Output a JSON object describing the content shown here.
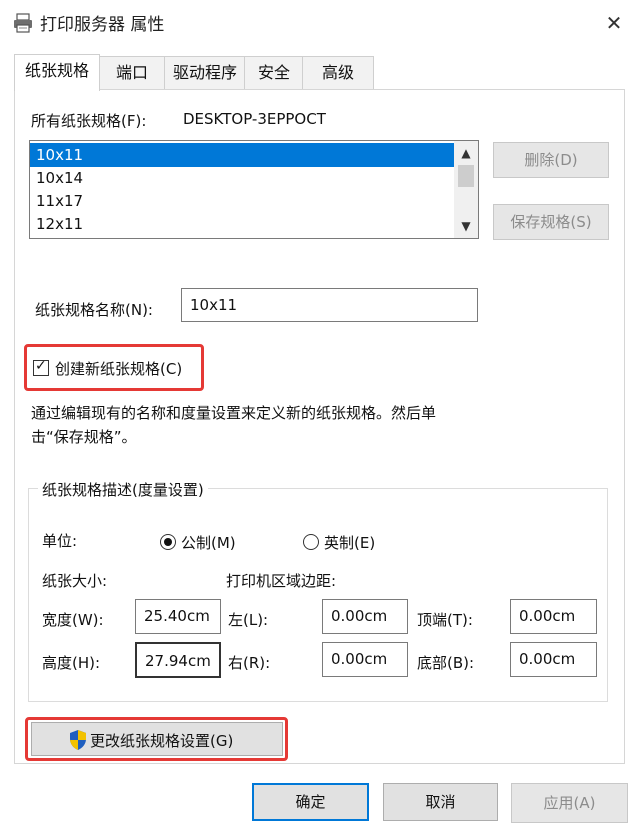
{
  "window": {
    "title": "打印服务器 属性",
    "close_glyph": "✕",
    "icon": "printer-icon"
  },
  "tabs": [
    {
      "label": "纸张规格",
      "active": true
    },
    {
      "label": "端口",
      "active": false
    },
    {
      "label": "驱动程序",
      "active": false
    },
    {
      "label": "安全",
      "active": false
    },
    {
      "label": "高级",
      "active": false
    }
  ],
  "forms": {
    "all_forms_label": "所有纸张规格(F):",
    "server_name": "DESKTOP-3EPPOCT",
    "items": [
      "10x11",
      "10x14",
      "11x17",
      "12x11"
    ],
    "selected": "10x11",
    "scroll_up": "▲",
    "scroll_down": "▼"
  },
  "buttons": {
    "delete": "删除(D)",
    "save_form": "保存规格(S)",
    "change_settings": "更改纸张规格设置(G)",
    "ok": "确定",
    "cancel": "取消",
    "apply": "应用(A)"
  },
  "form_name": {
    "label": "纸张规格名称(N):",
    "value": "10x11"
  },
  "create_new": {
    "label": "创建新纸张规格(C)",
    "checked": true,
    "check_glyph": "✓"
  },
  "description": {
    "line1": "通过编辑现有的名称和度量设置来定义新的纸张规格。然后单",
    "line2": "击“保存规格”。"
  },
  "measurements": {
    "group_title": "纸张规格描述(度量设置)",
    "units_label": "单位:",
    "metric_label": "公制(M)",
    "english_label": "英制(E)",
    "selected_unit": "metric",
    "paper_size_label": "纸张大小:",
    "margins_label": "打印机区域边距:",
    "width_label": "宽度(W):",
    "width_value": "25.40cm",
    "height_label": "高度(H):",
    "height_value": "27.94cm",
    "left_label": "左(L):",
    "left_value": "0.00cm",
    "right_label": "右(R):",
    "right_value": "0.00cm",
    "top_label": "顶端(T):",
    "top_value": "0.00cm",
    "bottom_label": "底部(B):",
    "bottom_value": "0.00cm"
  },
  "colors": {
    "accent": "#0078d7",
    "highlight": "#e53935",
    "shield_blue": "#1f5fbf",
    "shield_yellow": "#f2c200"
  }
}
